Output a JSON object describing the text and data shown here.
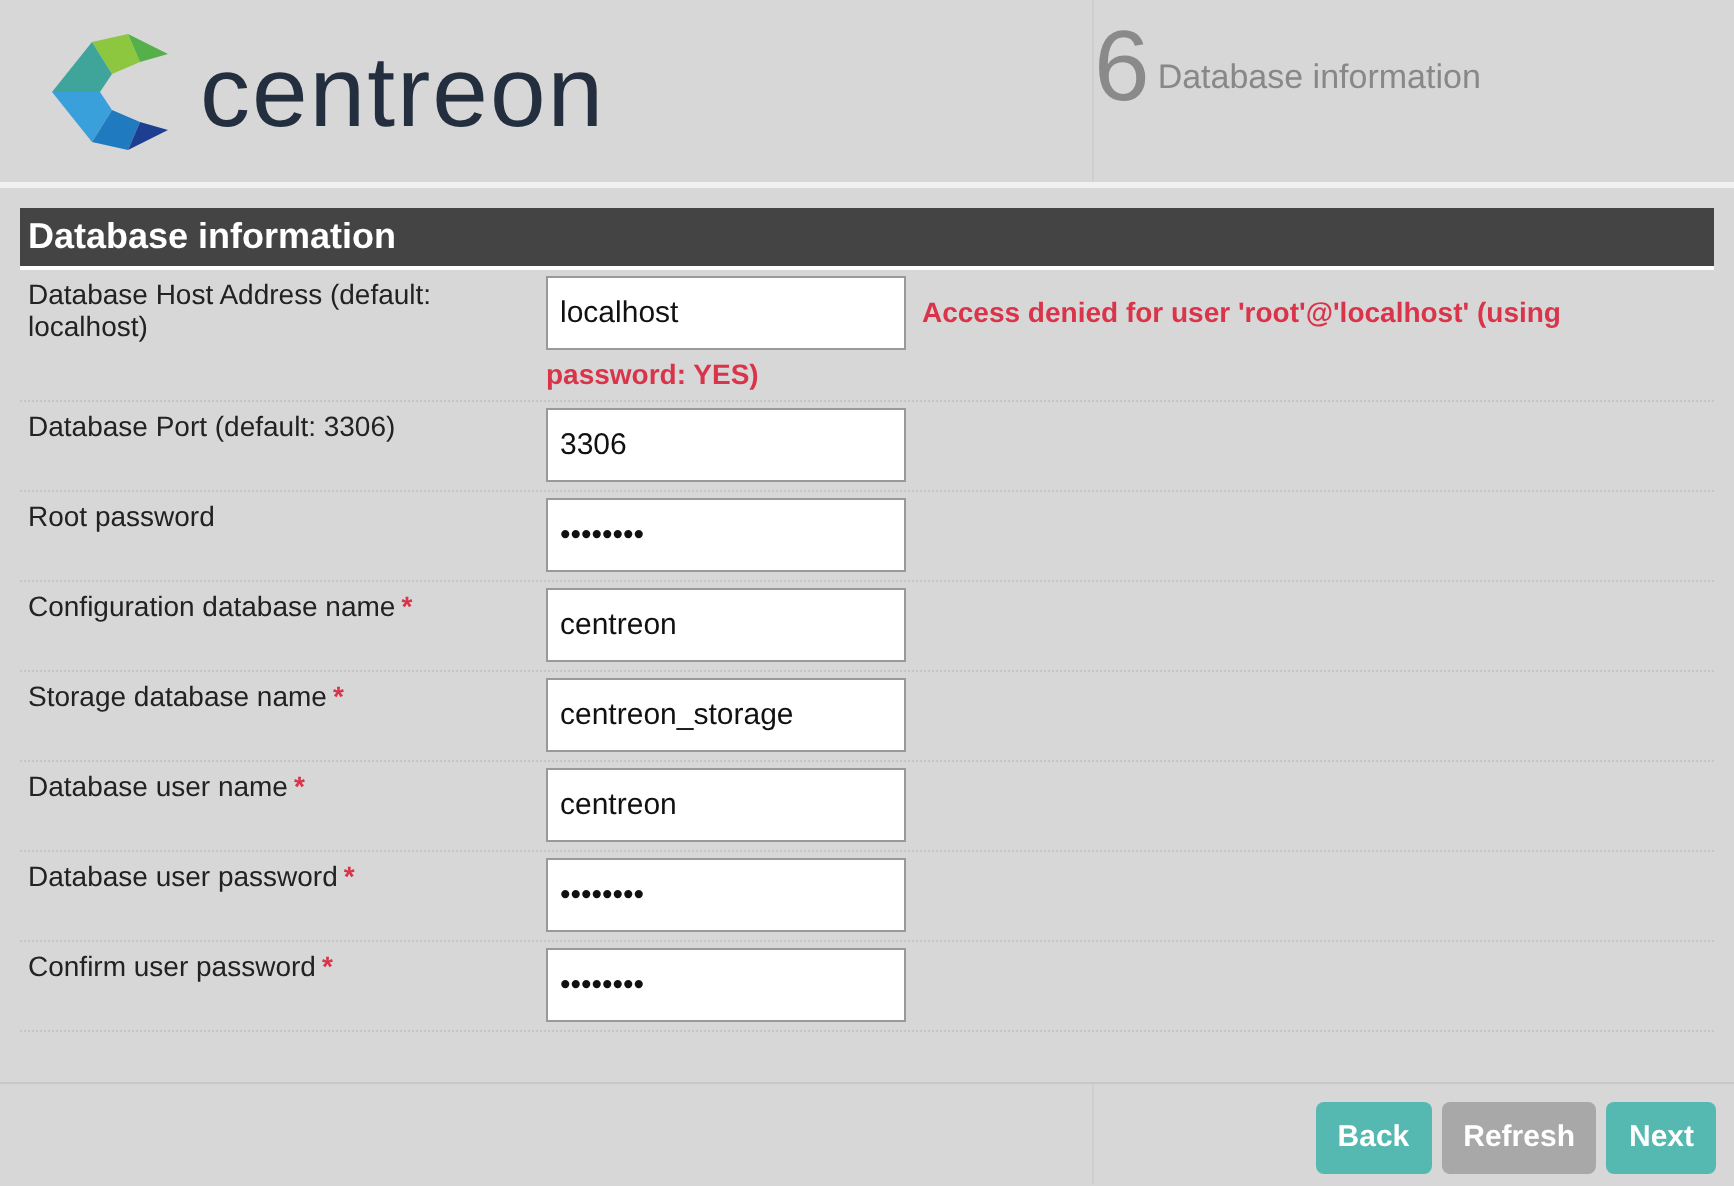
{
  "header": {
    "brand": "centreon",
    "step_number": "6",
    "step_title": "Database information"
  },
  "section_title": "Database information",
  "fields": [
    {
      "label": "Database Host Address (default: localhost)",
      "value": "localhost",
      "error_lines": [
        "Access denied for user 'root'@'localhost' (using",
        "password: YES)"
      ]
    },
    {
      "label": "Database Port (default: 3306)",
      "value": "3306"
    },
    {
      "label": "Root password",
      "value": "••••••••"
    },
    {
      "label": "Configuration database name",
      "required_mark": "*",
      "value": "centreon"
    },
    {
      "label": "Storage database name",
      "required_mark": "*",
      "value": "centreon_storage"
    },
    {
      "label": "Database user name",
      "required_mark": "*",
      "value": "centreon"
    },
    {
      "label": "Database user password",
      "required_mark": "*",
      "value": "••••••••"
    },
    {
      "label": "Confirm user password",
      "required_mark": "*",
      "value": "••••••••"
    }
  ],
  "buttons": [
    {
      "label": "Back",
      "kind": "primary"
    },
    {
      "label": "Refresh",
      "kind": "secondary"
    },
    {
      "label": "Next",
      "kind": "primary"
    }
  ]
}
